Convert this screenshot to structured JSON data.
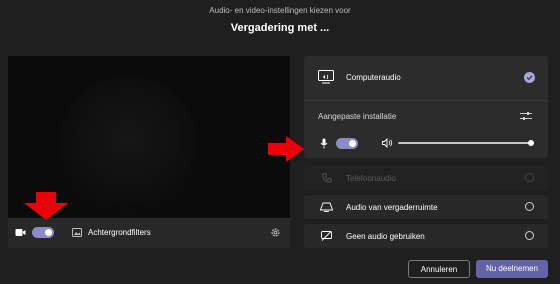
{
  "header": {
    "subtitle": "Audio- en video-instellingen kiezen voor",
    "title": "Vergadering met ..."
  },
  "video": {
    "camera_toggle_on": true,
    "background_filters_label": "Achtergrondfilters"
  },
  "audio": {
    "computer_audio_label": "Computeraudio",
    "custom_setup_label": "Aangepaste installatie",
    "mic_toggle_on": true,
    "speaker_volume": 1.0,
    "options": [
      {
        "label": "Telefoonaudio",
        "enabled": false
      },
      {
        "label": "Audio van vergaderruimte",
        "enabled": true
      },
      {
        "label": "Geen audio gebruiken",
        "enabled": true
      }
    ]
  },
  "actions": {
    "cancel_label": "Annuleren",
    "join_label": "Nu deelnemen"
  },
  "colors": {
    "accent": "#6264a7",
    "toggle": "#8b8cc7",
    "arrow": "#e8000b",
    "background": "#201f1f"
  }
}
